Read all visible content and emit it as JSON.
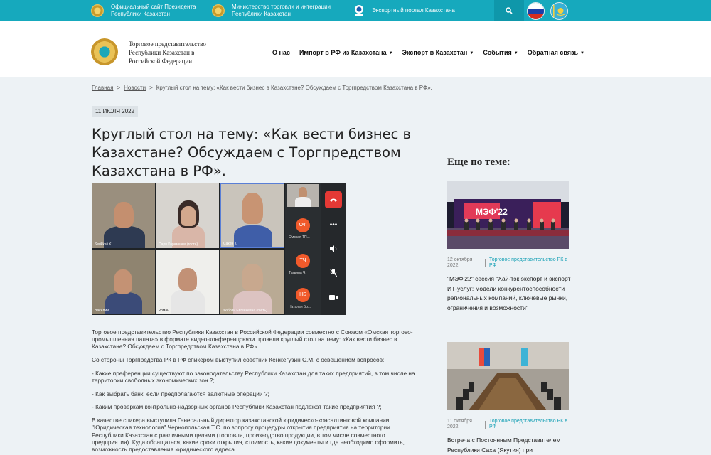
{
  "topbar": {
    "links": [
      {
        "label_line1": "Официальный сайт Президента",
        "label_line2": "Республики Казахстан",
        "icon": "emblem-icon"
      },
      {
        "label_line1": "Министерство торговли и интеграции",
        "label_line2": "Республики Казахстан",
        "icon": "emblem-icon"
      },
      {
        "label_line1": "Экспортный портал Казахстана",
        "label_line2": "",
        "icon": "expo-logo-icon"
      }
    ],
    "search_icon": "search-icon",
    "flags": [
      "russia-flag-icon",
      "kazakhstan-flag-icon"
    ]
  },
  "header": {
    "org_name": "Торговое представительство Республики Казахстан в Российской Федерации",
    "nav": [
      {
        "label": "О нас",
        "dropdown": false
      },
      {
        "label": "Импорт в РФ из Казахстана",
        "dropdown": true
      },
      {
        "label": "Экспорт в Казахстан",
        "dropdown": true
      },
      {
        "label": "События",
        "dropdown": true
      },
      {
        "label": "Обратная связь",
        "dropdown": true
      }
    ]
  },
  "breadcrumb": {
    "home": "Главная",
    "section": "Новости",
    "sep": ">",
    "current": "Круглый стол на тему: «Как вести бизнес в Казахстане? Обсуждаем с Торгпредством Казахстана в РФ»."
  },
  "article": {
    "date": "11 ИЮЛЯ 2022",
    "title": "Круглый стол на тему: «Как вести бизнес в Казахстане? Обсуждаем с Торгпредством Казахстана в РФ».",
    "video": {
      "tiles": [
        "Serikkali K.",
        "Саря Каримкана (гость)",
        "Сакен К.",
        "Василий",
        "Роман",
        "Любовь Евгеньевна (гость)"
      ],
      "side_participants": [
        {
          "initials": "",
          "name": ""
        },
        {
          "initials": "ОФ",
          "name": "Омская ТП..."
        },
        {
          "initials": "ТЧ",
          "name": "Татьяна Ч."
        },
        {
          "initials": "НБ",
          "name": "Наталья Бо..."
        }
      ]
    },
    "paragraphs": [
      "Торговое представительство Республики Казахстан в Российской Федерации совместно с Союзом «Омская торгово-промышленная палата» в формате видео-конференцсвязи провели круглый стол на тему: «Как вести бизнес в Казахстане? Обсуждаем с Торгпредством Казахстана в РФ».",
      "Со стороны Торгпредства РК в РФ спикером выступил советник Кенжегузин С.М. с освещением вопросов:",
      "- Какие преференции существуют по законодательству Республики Казахстан для таких предприятий, в том числе на территории свободных экономических зон ?;",
      "- Как выбрать банк, если предполагаются валютные операции ?;",
      "- Каким проверкам контрольно-надзорных органов Республики Казахстан подлежат такие предприятия ?;",
      "В качестве спикера выступила Генеральный директор казахстанской юридическо-консалтинговой компании \"Юридическая технология\" Чернопольская Т.С. по вопросу процедуры открытия предприятия на территории Республики Казахстан с различными целями (торговля, производство продукции, в том числе совместного предприятия). Куда обращаться, какие сроки открытия, стоимость, какие документы и где необходимо оформить, возможность предоставления юридического адреса."
    ]
  },
  "sidebar": {
    "title": "Еще по теме:",
    "cards": [
      {
        "date": "12 октября 2022",
        "source": "Торговое представительство РК в РФ",
        "text": "\"МЭФ'22\" сессия \"Хай-тэк экспорт и экспорт ИТ-услуг: модели конкурентоспособности региональных компаний, ключевые рынки, ограничения и возможности\"",
        "image_sign": "МЭФ'22"
      },
      {
        "date": "11 октября 2022",
        "source": "Торговое представительство РК в РФ",
        "text": "Встреча с Постоянным Представителем Республики Саха (Якутия) при"
      }
    ]
  }
}
